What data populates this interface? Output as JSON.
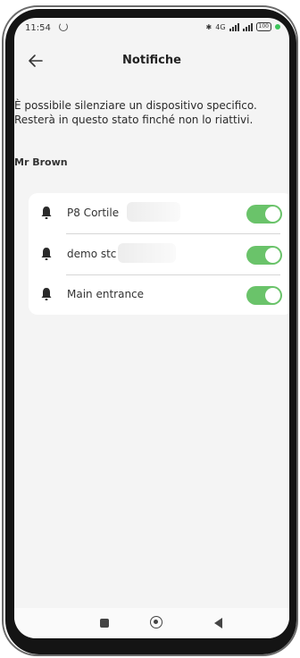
{
  "status_bar": {
    "time": "11:54",
    "network": "4G",
    "battery": "100"
  },
  "header": {
    "title": "Notifiche"
  },
  "description": "È possibile silenziare un dispositivo specifico. Resterà in questo stato finché non lo riattivi.",
  "owner": "Mr Brown",
  "devices": [
    {
      "label": "P8 Cortile",
      "enabled": true
    },
    {
      "label": "demo stc",
      "enabled": true
    },
    {
      "label": "Main entrance",
      "enabled": true
    }
  ],
  "colors": {
    "toggle_on": "#6ac36a",
    "background": "#f4f4f4",
    "card": "#ffffff"
  }
}
